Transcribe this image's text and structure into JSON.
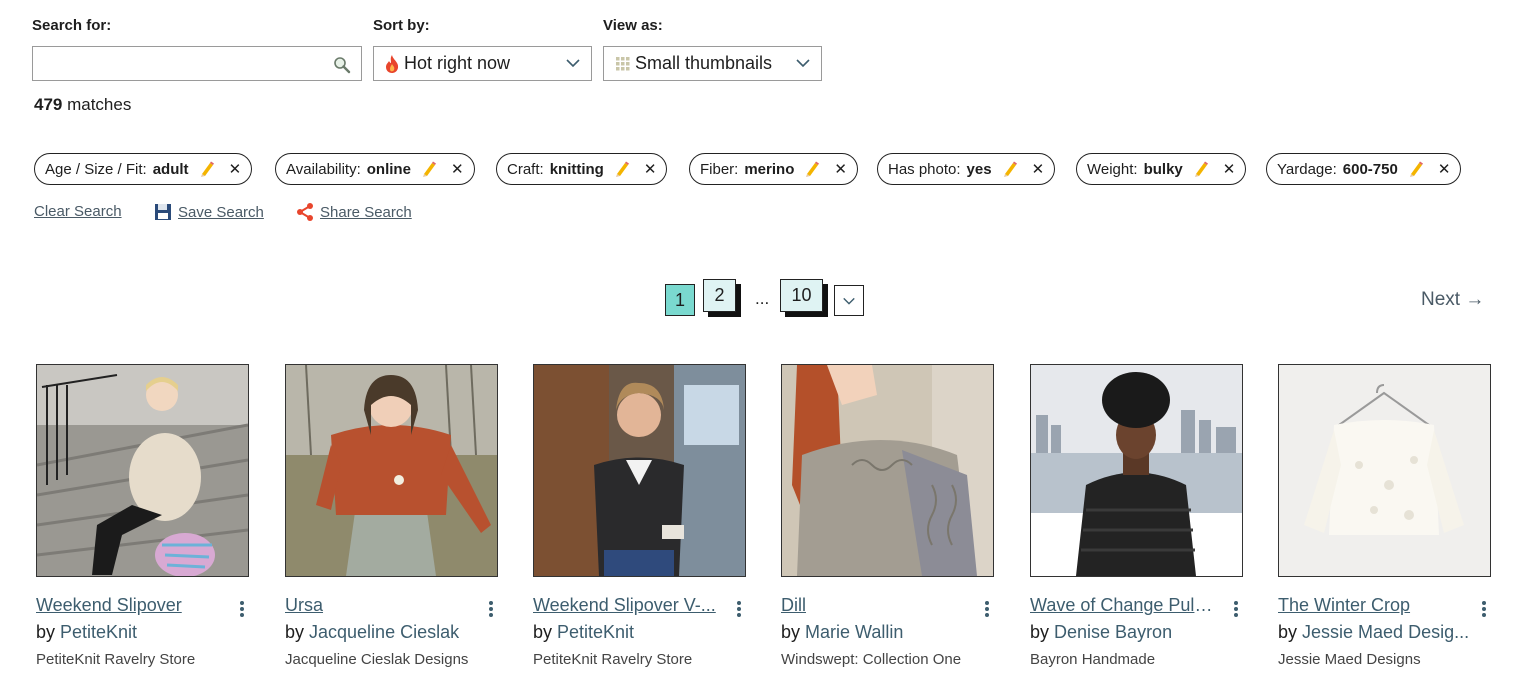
{
  "search": {
    "label": "Search for:",
    "value": "",
    "placeholder": ""
  },
  "sort": {
    "label": "Sort by:",
    "selected": "Hot right now"
  },
  "view": {
    "label": "View as:",
    "selected": "Small thumbnails"
  },
  "results": {
    "count": "479",
    "suffix": " matches"
  },
  "filters": [
    {
      "key": "Age / Size / Fit:",
      "value": "adult"
    },
    {
      "key": "Availability:",
      "value": "online"
    },
    {
      "key": "Craft:",
      "value": "knitting"
    },
    {
      "key": "Fiber:",
      "value": "merino"
    },
    {
      "key": "Has photo:",
      "value": "yes"
    },
    {
      "key": "Weight:",
      "value": "bulky"
    },
    {
      "key": "Yardage:",
      "value": "600-750"
    }
  ],
  "actions": {
    "clear": "Clear Search",
    "save": "Save Search",
    "share": "Share Search"
  },
  "pagination": {
    "current": "1",
    "pages": [
      "2",
      "10"
    ],
    "ellipsis": "...",
    "next": "Next →"
  },
  "patterns": [
    {
      "title": "Weekend Slipover",
      "by": "by ",
      "author": "PetiteKnit",
      "source": "PetiteKnit Ravelry Store"
    },
    {
      "title": "Ursa",
      "by": "by ",
      "author": "Jacqueline Cieslak",
      "source": "Jacqueline Cieslak Designs"
    },
    {
      "title": "Weekend Slipover V-...",
      "by": "by ",
      "author": "PetiteKnit",
      "source": "PetiteKnit Ravelry Store"
    },
    {
      "title": "Dill",
      "by": "by ",
      "author": "Marie Wallin",
      "source": "Windswept: Collection One"
    },
    {
      "title": "Wave of Change Pullo...",
      "by": "by ",
      "author": "Denise Bayron",
      "source": "Bayron Handmade"
    },
    {
      "title": "The Winter Crop",
      "by": "by ",
      "author": "Jessie Maed Desig...",
      "source": "Jessie Maed Designs"
    }
  ],
  "colors": {
    "link": "#3d5d6e",
    "page_active": "#7ad9cf",
    "page_inactive": "#dff3f3"
  }
}
